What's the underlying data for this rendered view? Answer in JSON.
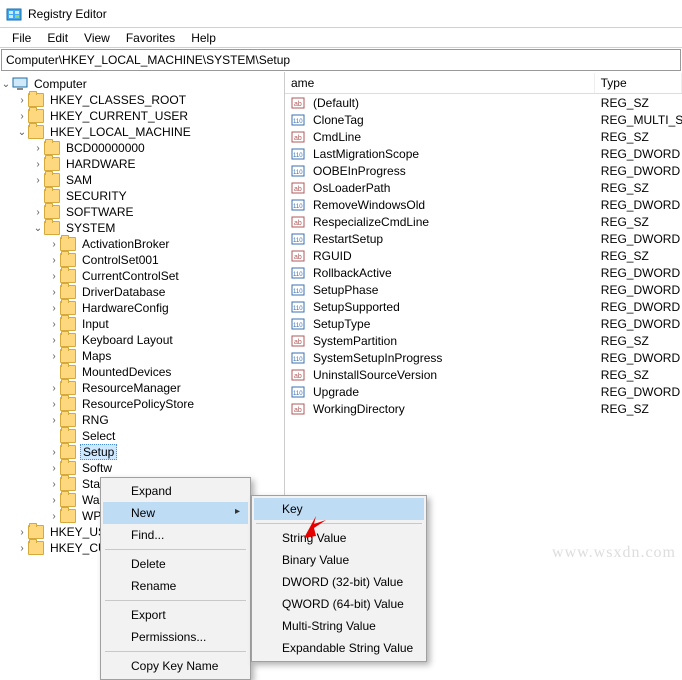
{
  "window": {
    "title": "Registry Editor"
  },
  "menubar": [
    "File",
    "Edit",
    "View",
    "Favorites",
    "Help"
  ],
  "address": "Computer\\HKEY_LOCAL_MACHINE\\SYSTEM\\Setup",
  "tree": {
    "root": "Computer",
    "hives": [
      {
        "name": "HKEY_CLASSES_ROOT",
        "state": "closed"
      },
      {
        "name": "HKEY_CURRENT_USER",
        "state": "closed"
      },
      {
        "name": "HKEY_LOCAL_MACHINE",
        "state": "open",
        "children": [
          {
            "name": "BCD00000000",
            "state": "closed"
          },
          {
            "name": "HARDWARE",
            "state": "closed"
          },
          {
            "name": "SAM",
            "state": "closed"
          },
          {
            "name": "SECURITY",
            "state": "none"
          },
          {
            "name": "SOFTWARE",
            "state": "closed"
          },
          {
            "name": "SYSTEM",
            "state": "open",
            "children": [
              {
                "name": "ActivationBroker",
                "state": "closed"
              },
              {
                "name": "ControlSet001",
                "state": "closed"
              },
              {
                "name": "CurrentControlSet",
                "state": "closed"
              },
              {
                "name": "DriverDatabase",
                "state": "closed"
              },
              {
                "name": "HardwareConfig",
                "state": "closed"
              },
              {
                "name": "Input",
                "state": "closed"
              },
              {
                "name": "Keyboard Layout",
                "state": "closed"
              },
              {
                "name": "Maps",
                "state": "closed"
              },
              {
                "name": "MountedDevices",
                "state": "none"
              },
              {
                "name": "ResourceManager",
                "state": "closed"
              },
              {
                "name": "ResourcePolicyStore",
                "state": "closed"
              },
              {
                "name": "RNG",
                "state": "closed"
              },
              {
                "name": "Select",
                "state": "none"
              },
              {
                "name": "Setup",
                "state": "closed",
                "selected": true
              },
              {
                "name": "Softw",
                "state": "closed"
              },
              {
                "name": "State",
                "state": "closed"
              },
              {
                "name": "WaaS",
                "state": "closed"
              },
              {
                "name": "WPA",
                "state": "closed"
              }
            ]
          }
        ]
      },
      {
        "name": "HKEY_USEI",
        "state": "closed"
      },
      {
        "name": "HKEY_CUR",
        "state": "closed"
      }
    ]
  },
  "list": {
    "columns": {
      "name": "ame",
      "type": "Type"
    },
    "rows": [
      {
        "name": "(Default)",
        "type": "REG_SZ",
        "kind": "sz"
      },
      {
        "name": "CloneTag",
        "type": "REG_MULTI_SZ",
        "kind": "bin"
      },
      {
        "name": "CmdLine",
        "type": "REG_SZ",
        "kind": "sz"
      },
      {
        "name": "LastMigrationScope",
        "type": "REG_DWORD",
        "kind": "bin"
      },
      {
        "name": "OOBEInProgress",
        "type": "REG_DWORD",
        "kind": "bin"
      },
      {
        "name": "OsLoaderPath",
        "type": "REG_SZ",
        "kind": "sz"
      },
      {
        "name": "RemoveWindowsOld",
        "type": "REG_DWORD",
        "kind": "bin"
      },
      {
        "name": "RespecializeCmdLine",
        "type": "REG_SZ",
        "kind": "sz"
      },
      {
        "name": "RestartSetup",
        "type": "REG_DWORD",
        "kind": "bin"
      },
      {
        "name": "RGUID",
        "type": "REG_SZ",
        "kind": "sz"
      },
      {
        "name": "RollbackActive",
        "type": "REG_DWORD",
        "kind": "bin"
      },
      {
        "name": "SetupPhase",
        "type": "REG_DWORD",
        "kind": "bin"
      },
      {
        "name": "SetupSupported",
        "type": "REG_DWORD",
        "kind": "bin"
      },
      {
        "name": "SetupType",
        "type": "REG_DWORD",
        "kind": "bin"
      },
      {
        "name": "SystemPartition",
        "type": "REG_SZ",
        "kind": "sz"
      },
      {
        "name": "SystemSetupInProgress",
        "type": "REG_DWORD",
        "kind": "bin"
      },
      {
        "name": "UninstallSourceVersion",
        "type": "REG_SZ",
        "kind": "sz"
      },
      {
        "name": "Upgrade",
        "type": "REG_DWORD",
        "kind": "bin"
      },
      {
        "name": "WorkingDirectory",
        "type": "REG_SZ",
        "kind": "sz"
      }
    ]
  },
  "context_menu": {
    "items": [
      {
        "label": "Expand"
      },
      {
        "label": "New",
        "highlight": true,
        "submenu": true
      },
      {
        "label": "Find..."
      },
      {
        "sep": true
      },
      {
        "label": "Delete"
      },
      {
        "label": "Rename"
      },
      {
        "sep": true
      },
      {
        "label": "Export"
      },
      {
        "label": "Permissions..."
      },
      {
        "sep": true
      },
      {
        "label": "Copy Key Name"
      }
    ],
    "submenu": [
      {
        "label": "Key",
        "highlight": true
      },
      {
        "sep": true
      },
      {
        "label": "String Value"
      },
      {
        "label": "Binary Value"
      },
      {
        "label": "DWORD (32-bit) Value"
      },
      {
        "label": "QWORD (64-bit) Value"
      },
      {
        "label": "Multi-String Value"
      },
      {
        "label": "Expandable String Value"
      }
    ]
  },
  "watermark": "www.wsxdn.com"
}
